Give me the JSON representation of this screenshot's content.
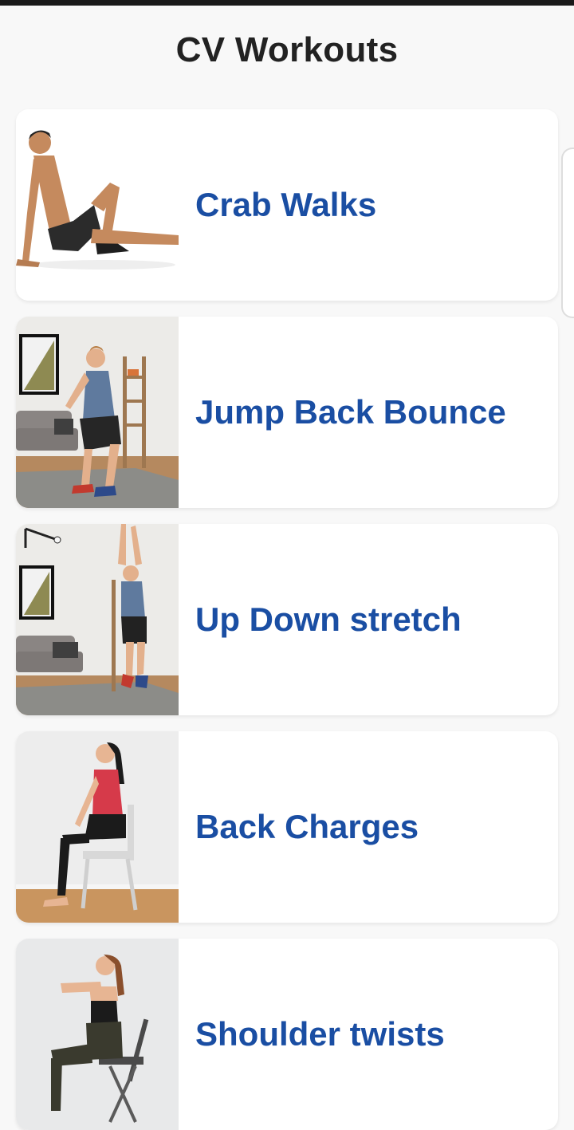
{
  "app": {
    "title": "CV Workouts"
  },
  "workouts": [
    {
      "label": "Crab Walks",
      "image": "man-crab-walk-pose"
    },
    {
      "label": "Jump Back Bounce",
      "image": "man-squat-living-room"
    },
    {
      "label": "Up Down stretch",
      "image": "man-jumping-arms-up"
    },
    {
      "label": "Back Charges",
      "image": "woman-seated-on-chair"
    },
    {
      "label": "Shoulder twists",
      "image": "woman-chair-squat-arms-forward"
    }
  ],
  "colors": {
    "label": "#1a4ea3",
    "background": "#f8f8f8",
    "card": "#ffffff",
    "title": "#222222"
  }
}
